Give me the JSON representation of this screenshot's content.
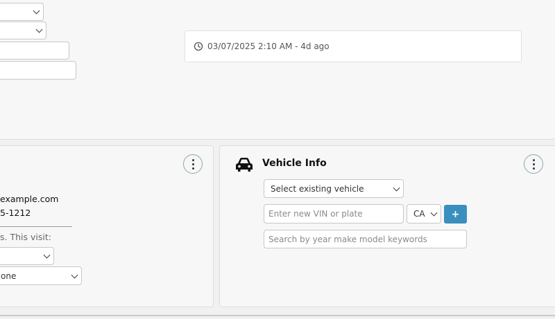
{
  "timestamp": {
    "text": "03/07/2025 2:10 AM - 4d ago",
    "icon": "clock-icon"
  },
  "customer_card": {
    "email_fragment": "example.com",
    "phone_fragment": "5-1212",
    "visit_text": "s. This visit:",
    "select_value": "one"
  },
  "vehicle_card": {
    "title": "Vehicle Info",
    "existing_vehicle_select": "Select existing vehicle",
    "vin_placeholder": "Enter new VIN or plate",
    "state_select": "CA",
    "add_label": "+",
    "search_placeholder": "Search by year make model keywords"
  },
  "colors": {
    "accent": "#3a8fbf",
    "kebab_border": "#8aa8ac"
  }
}
